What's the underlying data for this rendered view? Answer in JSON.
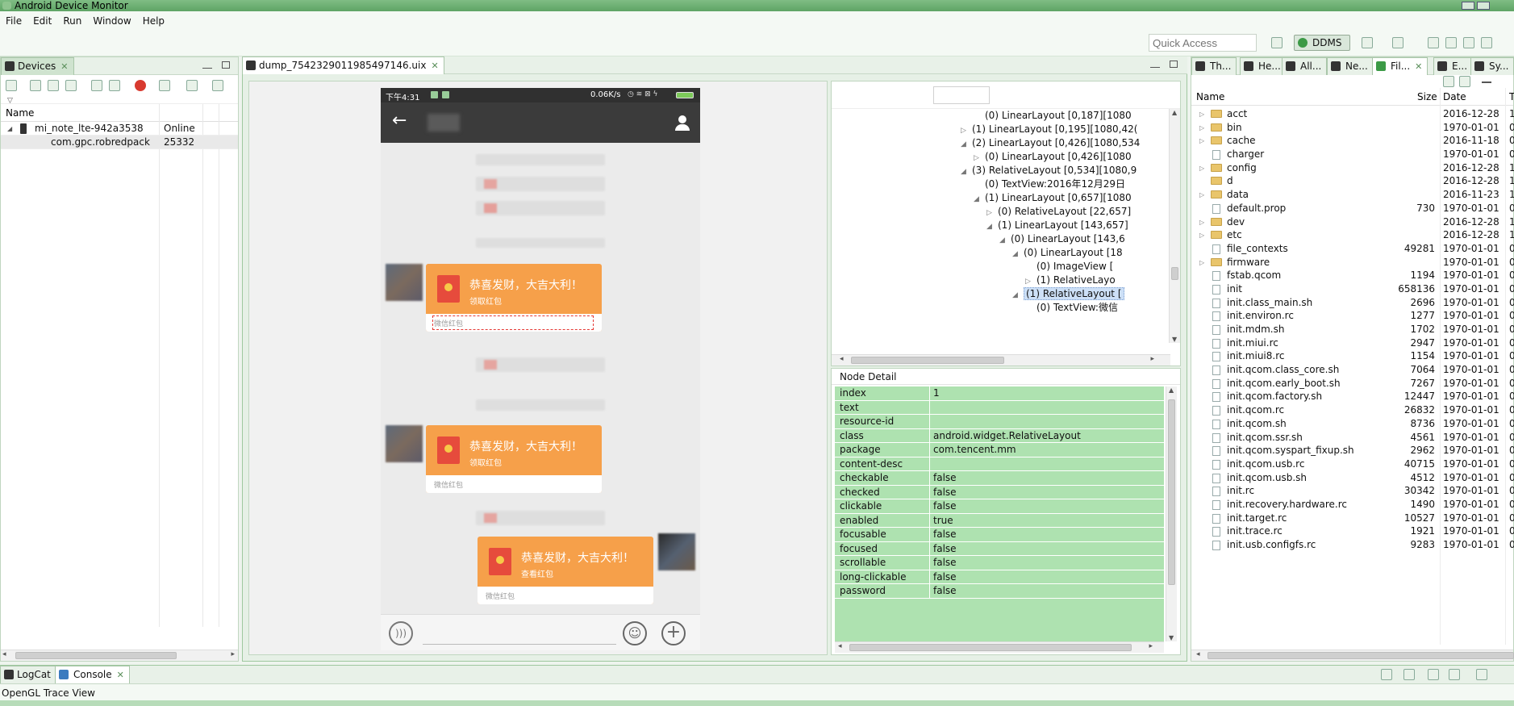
{
  "app": {
    "title": "Android Device Monitor"
  },
  "menu": [
    "File",
    "Edit",
    "Run",
    "Window",
    "Help"
  ],
  "toolbar": {
    "quick_access_placeholder": "Quick Access",
    "perspective": "DDMS"
  },
  "devices": {
    "tab": "Devices",
    "header": "Name",
    "rows": [
      {
        "name": "mi_note_lte-942a3538",
        "status": "Online"
      },
      {
        "name": "com.gpc.robredpack",
        "status": "25332"
      }
    ]
  },
  "dump": {
    "tab": "dump_7542329011985497146.uix",
    "phone": {
      "time": "下午4:31",
      "speed": "0.06K/s",
      "messages": [
        {
          "title": "恭喜发财，大吉大利！",
          "sub": "领取红包",
          "foot": "微信红包"
        },
        {
          "title": "恭喜发财，大吉大利！",
          "sub": "领取红包",
          "foot": "微信红包"
        },
        {
          "title": "恭喜发财，大吉大利！",
          "sub": "查看红包",
          "foot": "微信红包"
        }
      ]
    }
  },
  "tree": {
    "rows": [
      {
        "indent": 11,
        "toggle": "",
        "text": "(0) LinearLayout [0,187][1080"
      },
      {
        "indent": 10,
        "toggle": "▷",
        "text": "(1) LinearLayout [0,195][1080,42("
      },
      {
        "indent": 10,
        "toggle": "◢",
        "text": "(2) LinearLayout [0,426][1080,534"
      },
      {
        "indent": 11,
        "toggle": "▷",
        "text": "(0) LinearLayout [0,426][1080"
      },
      {
        "indent": 10,
        "toggle": "◢",
        "text": "(3) RelativeLayout [0,534][1080,9"
      },
      {
        "indent": 11,
        "toggle": "",
        "text": "(0) TextView:2016年12月29日"
      },
      {
        "indent": 11,
        "toggle": "◢",
        "text": "(1) LinearLayout [0,657][1080"
      },
      {
        "indent": 12,
        "toggle": "▷",
        "text": "(0) RelativeLayout [22,657]"
      },
      {
        "indent": 12,
        "toggle": "◢",
        "text": "(1) LinearLayout [143,657]"
      },
      {
        "indent": 13,
        "toggle": "◢",
        "text": "(0) LinearLayout [143,6"
      },
      {
        "indent": 14,
        "toggle": "◢",
        "text": "(0) LinearLayout [18"
      },
      {
        "indent": 15,
        "toggle": "",
        "text": "(0) ImageView ["
      },
      {
        "indent": 15,
        "toggle": "▷",
        "text": "(1) RelativeLayo"
      },
      {
        "indent": 14,
        "toggle": "◢",
        "text": "(1) RelativeLayout [",
        "selected": true
      },
      {
        "indent": 15,
        "toggle": "",
        "text": "(0) TextView:微信"
      }
    ]
  },
  "node_detail": {
    "title": "Node Detail",
    "rows": [
      {
        "k": "index",
        "v": "1"
      },
      {
        "k": "text",
        "v": ""
      },
      {
        "k": "resource-id",
        "v": ""
      },
      {
        "k": "class",
        "v": "android.widget.RelativeLayout"
      },
      {
        "k": "package",
        "v": "com.tencent.mm"
      },
      {
        "k": "content-desc",
        "v": ""
      },
      {
        "k": "checkable",
        "v": "false"
      },
      {
        "k": "checked",
        "v": "false"
      },
      {
        "k": "clickable",
        "v": "false"
      },
      {
        "k": "enabled",
        "v": "true"
      },
      {
        "k": "focusable",
        "v": "false"
      },
      {
        "k": "focused",
        "v": "false"
      },
      {
        "k": "scrollable",
        "v": "false"
      },
      {
        "k": "long-clickable",
        "v": "false"
      },
      {
        "k": "password",
        "v": "false"
      }
    ]
  },
  "right_tabs": [
    "Th...",
    "He...",
    "All...",
    "Ne...",
    "Fil...",
    "E...",
    "Sy..."
  ],
  "file_explorer": {
    "headers": {
      "name": "Name",
      "size": "Size",
      "date": "Date",
      "t": "T"
    },
    "rows": [
      {
        "type": "dir",
        "name": "acct",
        "size": "",
        "date": "2016-12-28",
        "t": "1"
      },
      {
        "type": "dir",
        "name": "bin",
        "size": "",
        "date": "1970-01-01",
        "t": "0"
      },
      {
        "type": "dir",
        "name": "cache",
        "size": "",
        "date": "2016-11-18",
        "t": "0"
      },
      {
        "type": "file",
        "name": "charger",
        "size": "",
        "date": "1970-01-01",
        "t": "0"
      },
      {
        "type": "dir",
        "name": "config",
        "size": "",
        "date": "2016-12-28",
        "t": "1"
      },
      {
        "type": "dir0",
        "name": "d",
        "size": "",
        "date": "2016-12-28",
        "t": "1"
      },
      {
        "type": "dir",
        "name": "data",
        "size": "",
        "date": "2016-11-23",
        "t": "1"
      },
      {
        "type": "file",
        "name": "default.prop",
        "size": "730",
        "date": "1970-01-01",
        "t": "0"
      },
      {
        "type": "dir",
        "name": "dev",
        "size": "",
        "date": "2016-12-28",
        "t": "1"
      },
      {
        "type": "dir",
        "name": "etc",
        "size": "",
        "date": "2016-12-28",
        "t": "1"
      },
      {
        "type": "file",
        "name": "file_contexts",
        "size": "49281",
        "date": "1970-01-01",
        "t": "0"
      },
      {
        "type": "dir",
        "name": "firmware",
        "size": "",
        "date": "1970-01-01",
        "t": "0"
      },
      {
        "type": "file",
        "name": "fstab.qcom",
        "size": "1194",
        "date": "1970-01-01",
        "t": "0"
      },
      {
        "type": "file",
        "name": "init",
        "size": "658136",
        "date": "1970-01-01",
        "t": "0"
      },
      {
        "type": "file",
        "name": "init.class_main.sh",
        "size": "2696",
        "date": "1970-01-01",
        "t": "0"
      },
      {
        "type": "file",
        "name": "init.environ.rc",
        "size": "1277",
        "date": "1970-01-01",
        "t": "0"
      },
      {
        "type": "file",
        "name": "init.mdm.sh",
        "size": "1702",
        "date": "1970-01-01",
        "t": "0"
      },
      {
        "type": "file",
        "name": "init.miui.rc",
        "size": "2947",
        "date": "1970-01-01",
        "t": "0"
      },
      {
        "type": "file",
        "name": "init.miui8.rc",
        "size": "1154",
        "date": "1970-01-01",
        "t": "0"
      },
      {
        "type": "file",
        "name": "init.qcom.class_core.sh",
        "size": "7064",
        "date": "1970-01-01",
        "t": "0"
      },
      {
        "type": "file",
        "name": "init.qcom.early_boot.sh",
        "size": "7267",
        "date": "1970-01-01",
        "t": "0"
      },
      {
        "type": "file",
        "name": "init.qcom.factory.sh",
        "size": "12447",
        "date": "1970-01-01",
        "t": "0"
      },
      {
        "type": "file",
        "name": "init.qcom.rc",
        "size": "26832",
        "date": "1970-01-01",
        "t": "0"
      },
      {
        "type": "file",
        "name": "init.qcom.sh",
        "size": "8736",
        "date": "1970-01-01",
        "t": "0"
      },
      {
        "type": "file",
        "name": "init.qcom.ssr.sh",
        "size": "4561",
        "date": "1970-01-01",
        "t": "0"
      },
      {
        "type": "file",
        "name": "init.qcom.syspart_fixup.sh",
        "size": "2962",
        "date": "1970-01-01",
        "t": "0"
      },
      {
        "type": "file",
        "name": "init.qcom.usb.rc",
        "size": "40715",
        "date": "1970-01-01",
        "t": "0"
      },
      {
        "type": "file",
        "name": "init.qcom.usb.sh",
        "size": "4512",
        "date": "1970-01-01",
        "t": "0"
      },
      {
        "type": "file",
        "name": "init.rc",
        "size": "30342",
        "date": "1970-01-01",
        "t": "0"
      },
      {
        "type": "file",
        "name": "init.recovery.hardware.rc",
        "size": "1490",
        "date": "1970-01-01",
        "t": "0"
      },
      {
        "type": "file",
        "name": "init.target.rc",
        "size": "10527",
        "date": "1970-01-01",
        "t": "0"
      },
      {
        "type": "file",
        "name": "init.trace.rc",
        "size": "1921",
        "date": "1970-01-01",
        "t": "0"
      },
      {
        "type": "file",
        "name": "init.usb.configfs.rc",
        "size": "9283",
        "date": "1970-01-01",
        "t": "0"
      }
    ]
  },
  "bottom": {
    "tabs": [
      "LogCat",
      "Console"
    ],
    "status": "OpenGL Trace View"
  }
}
